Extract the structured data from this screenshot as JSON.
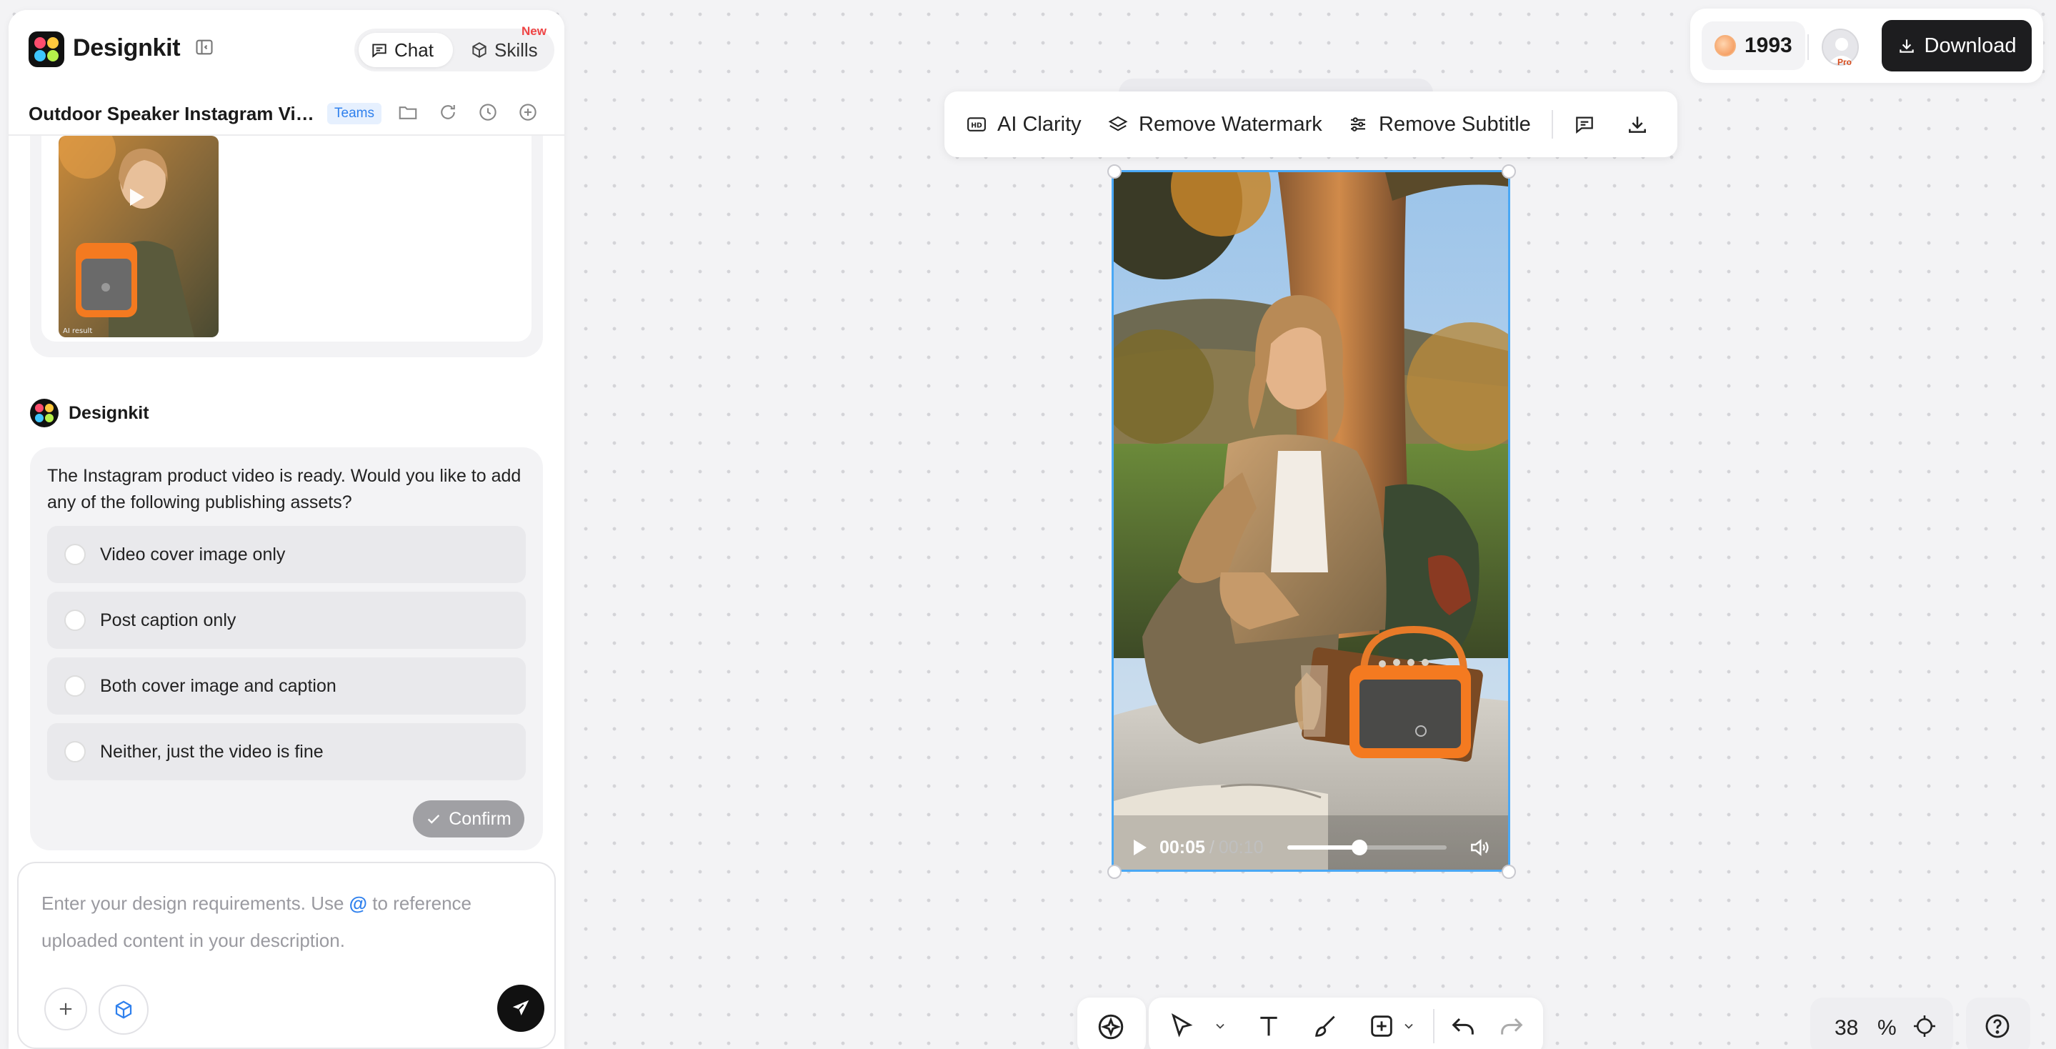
{
  "sidebar": {
    "brand": "Designkit",
    "tabs": {
      "chat": "Chat",
      "skills": "Skills",
      "new_badge": "New"
    },
    "project_title": "Outdoor Speaker Instagram Vid...",
    "teams_badge": "Teams",
    "thumbnail_caption": "AI result",
    "assistant_name": "Designkit",
    "reply_text": "The Instagram product video is ready. Would you like to add any of the following publishing assets?",
    "options": [
      {
        "label": "Video cover image only"
      },
      {
        "label": "Post caption only"
      },
      {
        "label": "Both cover image and caption"
      },
      {
        "label": "Neither, just the video is fine"
      }
    ],
    "confirm_label": "Confirm",
    "input": {
      "placeholder_before": "Enter your design requirements. Use",
      "at_symbol": "@",
      "placeholder_after": "to reference uploaded content in your description."
    }
  },
  "topbar": {
    "credits": "1993",
    "pro_tag": "Pro",
    "download_label": "Download"
  },
  "video_tools": {
    "ai_clarity": "AI Clarity",
    "remove_watermark": "Remove Watermark",
    "remove_subtitle": "Remove Subtitle"
  },
  "video": {
    "current_time": "00:05",
    "separator": "/",
    "total_time": "00:10",
    "progress": 0.45
  },
  "zoom": {
    "value": "38",
    "unit": "%"
  },
  "colors": {
    "accent_blue": "#2f80ed",
    "selection_blue": "#4aa8f5",
    "new_red": "#ef4444",
    "dark_button": "#1d1d1f",
    "speaker_orange": "#f47a20"
  },
  "icons": [
    "sidebar-collapse-icon",
    "chat-bubble-icon",
    "skills-cube-icon",
    "folder-icon",
    "refresh-icon",
    "history-icon",
    "add-circle-icon",
    "play-icon",
    "check-icon",
    "plus-icon",
    "cube-icon",
    "send-icon",
    "coin-icon",
    "download-icon",
    "hd-icon",
    "layers-icon",
    "sliders-icon",
    "comment-icon",
    "volume-icon",
    "ai-sparkle-icon",
    "pointer-icon",
    "text-icon",
    "brush-icon",
    "add-shape-icon",
    "undo-icon",
    "redo-icon",
    "focus-target-icon",
    "help-icon"
  ]
}
